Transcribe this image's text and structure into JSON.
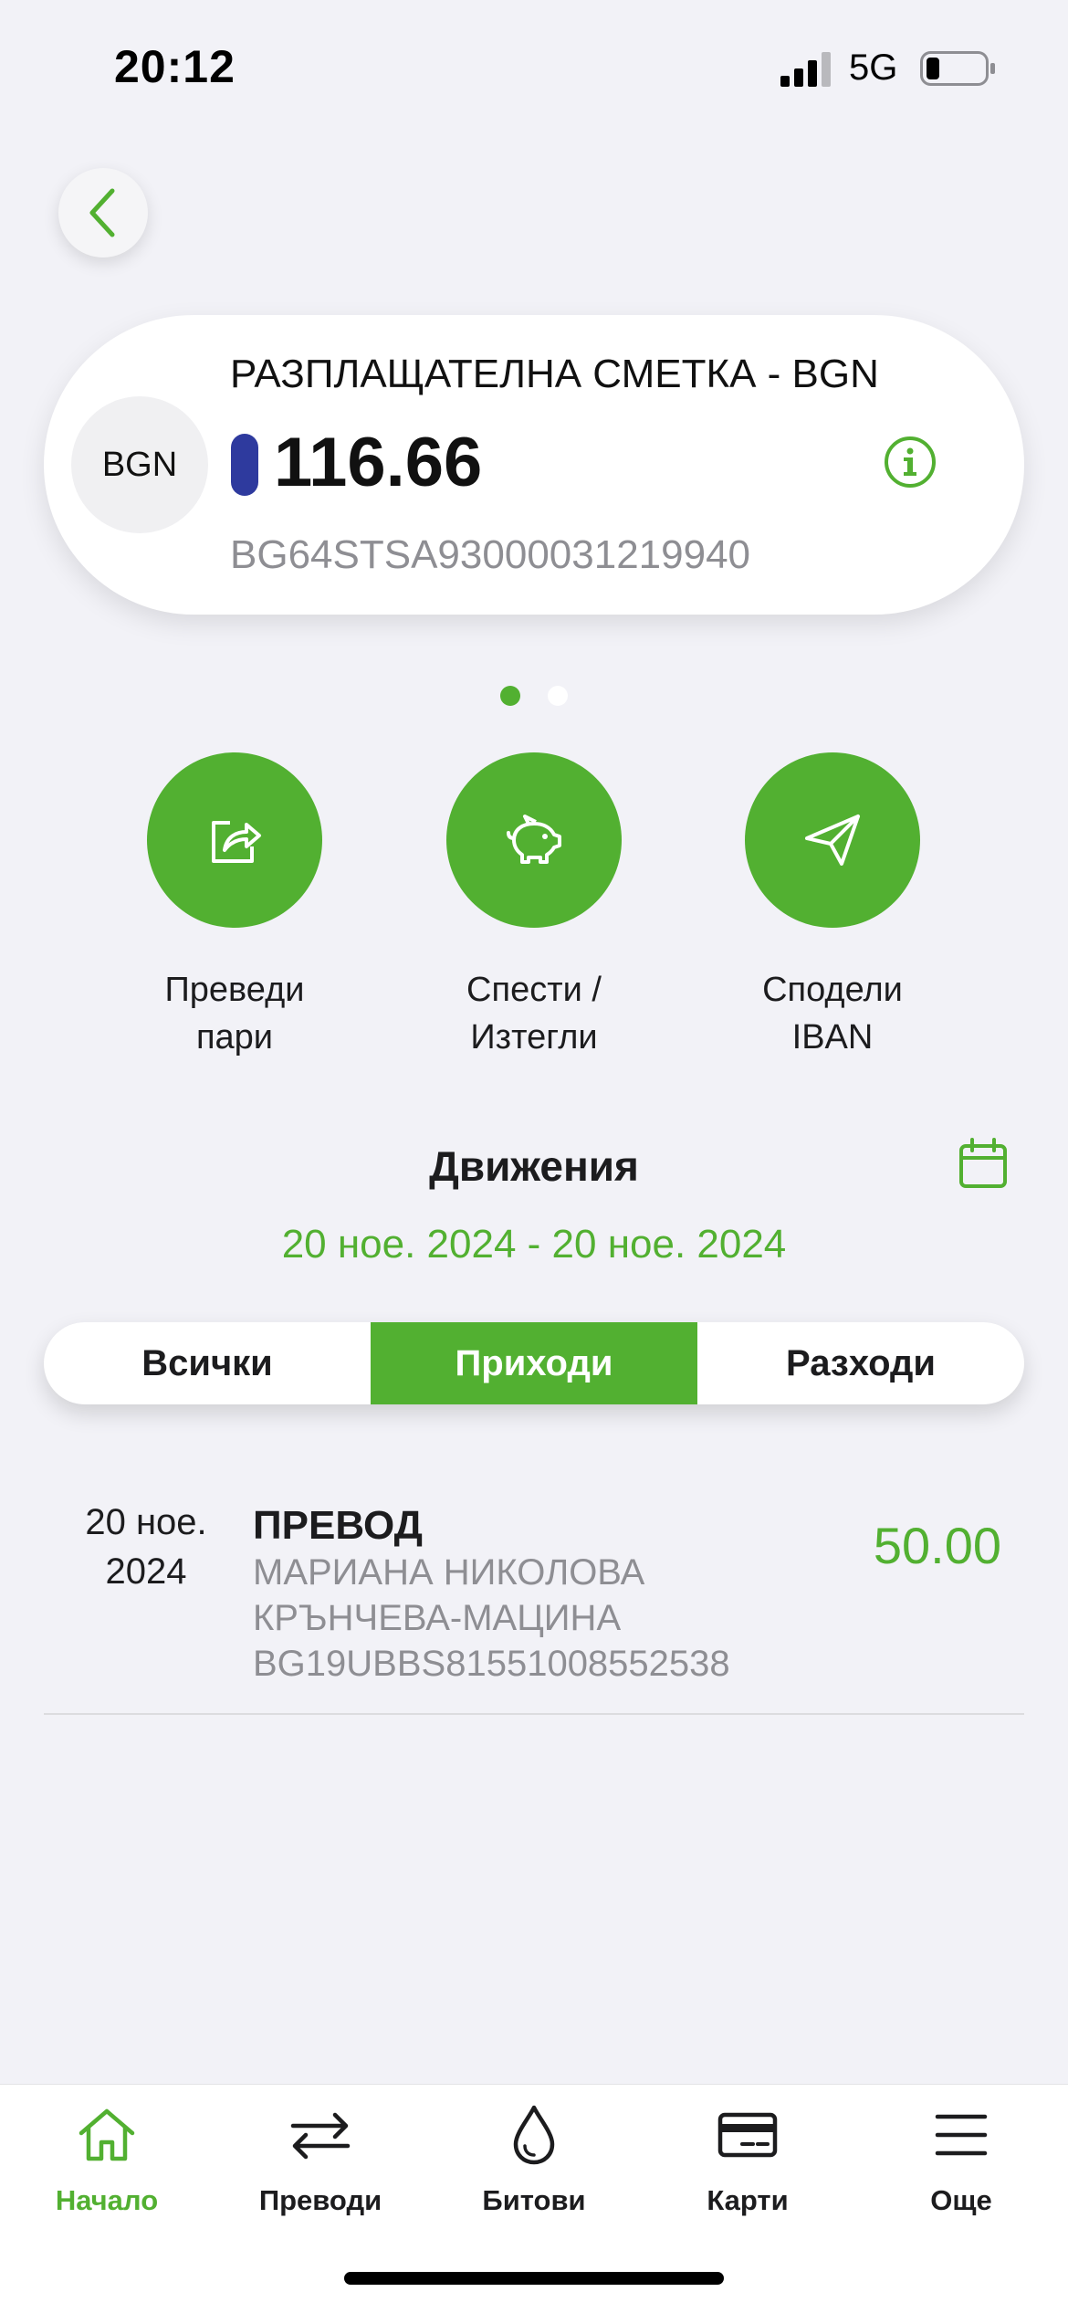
{
  "status_bar": {
    "time": "20:12",
    "network": "5G"
  },
  "account": {
    "currency_code": "BGN",
    "name": "РАЗПЛАЩАТЕЛНА СМЕТКА - BGN",
    "balance": "116.66",
    "iban": "BG64STSA93000031219940"
  },
  "pager": {
    "current": 1,
    "total": 2
  },
  "actions": [
    {
      "line1": "Преведи",
      "line2": "пари",
      "icon": "transfer-share-icon"
    },
    {
      "line1": "Спести /",
      "line2": "Изтегли",
      "icon": "piggy-bank-icon"
    },
    {
      "line1": "Сподели",
      "line2": "IBAN",
      "icon": "paper-plane-icon"
    }
  ],
  "movements": {
    "title": "Движения",
    "date_range": "20 ное. 2024 - 20 ное. 2024",
    "filters": [
      "Всички",
      "Приходи",
      "Разходи"
    ],
    "active_filter": "Приходи"
  },
  "transactions": [
    {
      "date_line1": "20 ное.",
      "date_line2": "2024",
      "title": "ПРЕВОД",
      "counterparty_line1": "МАРИАНА НИКОЛОВА",
      "counterparty_line2": "КРЪНЧЕВА-МАЦИНА",
      "counterparty_iban": "BG19UBBS81551008552538",
      "amount": "50.00"
    }
  ],
  "tabbar": {
    "items": [
      {
        "label": "Начало",
        "icon": "home-icon"
      },
      {
        "label": "Преводи",
        "icon": "transfer-arrows-icon"
      },
      {
        "label": "Битови",
        "icon": "drop-icon"
      },
      {
        "label": "Карти",
        "icon": "card-icon"
      },
      {
        "label": "Още",
        "icon": "menu-icon"
      }
    ],
    "active": "Начало"
  },
  "colors": {
    "accent": "#52b031",
    "balance_marker": "#2e3a9e",
    "background": "#f2f2f7",
    "muted_text": "#8e8e93"
  }
}
